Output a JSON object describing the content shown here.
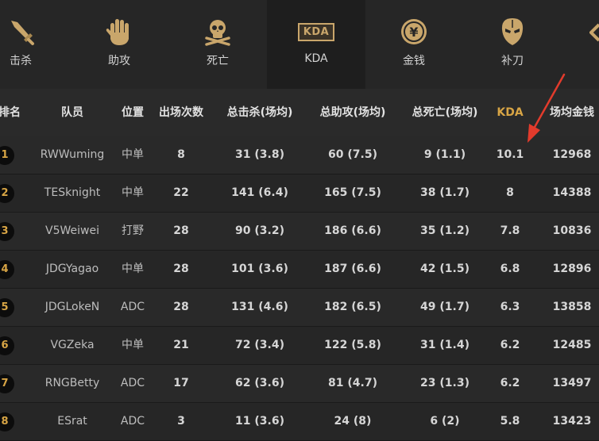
{
  "tabs": [
    {
      "label": "击杀",
      "icon": "sword-icon"
    },
    {
      "label": "助攻",
      "icon": "hand-icon"
    },
    {
      "label": "死亡",
      "icon": "skull-icon"
    },
    {
      "label": "KDA",
      "icon": "kda-badge-icon",
      "badge": "KDA"
    },
    {
      "label": "金钱",
      "icon": "coin-icon",
      "coin_symbol": "¥"
    },
    {
      "label": "补刀",
      "icon": "mask-icon"
    }
  ],
  "columns": [
    "排名",
    "队员",
    "位置",
    "出场次数",
    "总击杀(场均)",
    "总助攻(场均)",
    "总死亡(场均)",
    "KDA",
    "场均金钱"
  ],
  "rows": [
    {
      "rank": "1",
      "player": "RWWuming",
      "position": "中单",
      "games": "8",
      "kills": "31 (3.8)",
      "assists": "60 (7.5)",
      "deaths": "9 (1.1)",
      "kda": "10.1",
      "gold": "12968"
    },
    {
      "rank": "2",
      "player": "TESknight",
      "position": "中单",
      "games": "22",
      "kills": "141 (6.4)",
      "assists": "165 (7.5)",
      "deaths": "38 (1.7)",
      "kda": "8",
      "gold": "14388"
    },
    {
      "rank": "3",
      "player": "V5Weiwei",
      "position": "打野",
      "games": "28",
      "kills": "90 (3.2)",
      "assists": "186 (6.6)",
      "deaths": "35 (1.2)",
      "kda": "7.8",
      "gold": "10836"
    },
    {
      "rank": "4",
      "player": "JDGYagao",
      "position": "中单",
      "games": "28",
      "kills": "101 (3.6)",
      "assists": "187 (6.6)",
      "deaths": "42 (1.5)",
      "kda": "6.8",
      "gold": "12896"
    },
    {
      "rank": "5",
      "player": "JDGLokeN",
      "position": "ADC",
      "games": "28",
      "kills": "131 (4.6)",
      "assists": "182 (6.5)",
      "deaths": "49 (1.7)",
      "kda": "6.3",
      "gold": "13858"
    },
    {
      "rank": "6",
      "player": "VGZeka",
      "position": "中单",
      "games": "21",
      "kills": "72 (3.4)",
      "assists": "122 (5.8)",
      "deaths": "31 (1.4)",
      "kda": "6.2",
      "gold": "12485"
    },
    {
      "rank": "7",
      "player": "RNGBetty",
      "position": "ADC",
      "games": "17",
      "kills": "62 (3.6)",
      "assists": "81 (4.7)",
      "deaths": "23 (1.3)",
      "kda": "6.2",
      "gold": "13497"
    },
    {
      "rank": "8",
      "player": "ESrat",
      "position": "ADC",
      "games": "3",
      "kills": "11 (3.6)",
      "assists": "24 (8)",
      "deaths": "6 (2)",
      "kda": "5.8",
      "gold": "13423"
    }
  ],
  "colors": {
    "accent_gold": "#d8a545",
    "icon_gold": "#c9a66b",
    "annotation_red": "#e23b2c",
    "background": "#222222"
  }
}
